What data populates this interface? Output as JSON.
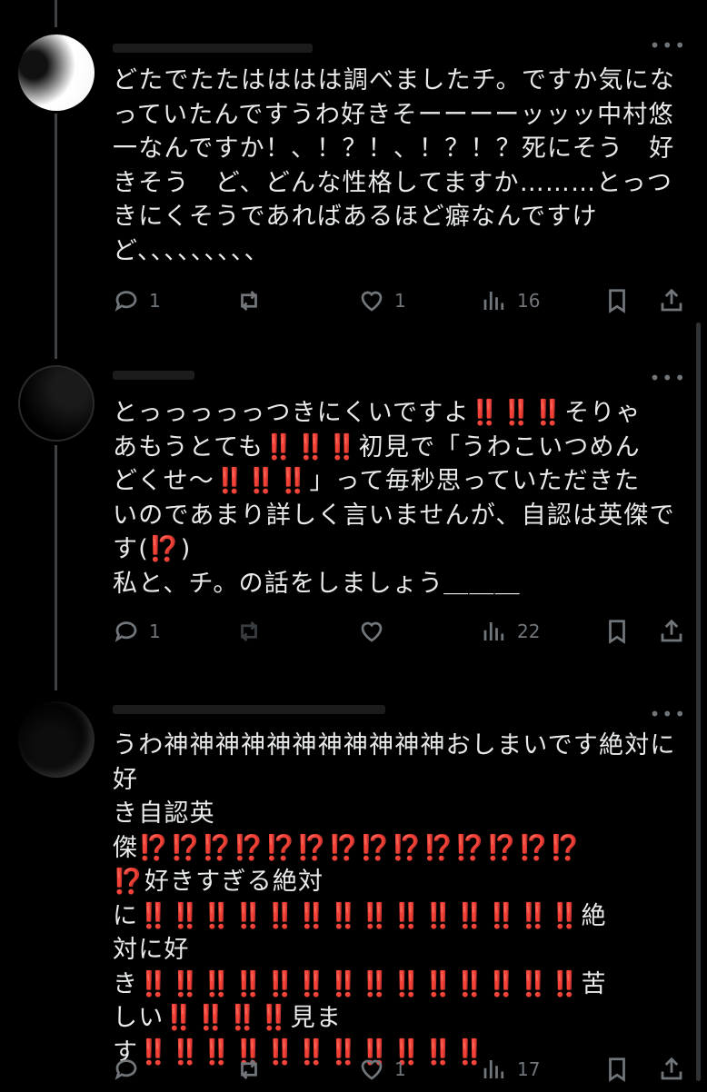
{
  "posts": [
    {
      "text": "どたでたたはははは調べましたチ。ですか気にな\nっていたんですうわ好きそーーーーッッッ中村悠\n一なんですか！、！？！、！？！？死にそう　好\nきそう　ど、どんな性格してますか………とっつ\nきにくそうであればあるほど癖なんですけ\nど、、、、、、、、、",
      "reply_count": "1",
      "repost_count": "",
      "like_count": "1",
      "view_count": "16"
    },
    {
      "text": "とっっっっっつきにくいですよ‼️‼️‼️そりゃ\nあもうとても‼️‼️‼️初見で「うわこいつめん\nどくせ〜‼️‼️‼️」って毎秒思っていただきた\nいのであまり詳しく言いませんが、自認は英傑で\nす(⁉️)\n私と、チ。の話をしましょう＿＿＿",
      "reply_count": "1",
      "repost_count": "",
      "like_count": "",
      "view_count": "22"
    },
    {
      "text": "うわ神神神神神神神神神神神おしまいです絶対に好\nき自認英\n傑⁉️⁉️⁉️⁉️⁉️⁉️⁉️⁉️⁉️⁉️⁉️⁉️⁉️⁉️\n⁉️好きすぎる絶対\nに‼️‼️‼️‼️‼️‼️‼️‼️‼️‼️‼️‼️‼️‼️絶\n対に好\nき‼️‼️‼️‼️‼️‼️‼️‼️‼️‼️‼️‼️‼️‼️苦\nしい‼️‼️‼️‼️見ま\nす‼️‼️‼️‼️‼️‼️‼️‼️‼️‼️‼️",
      "reply_count": "",
      "repost_count": "",
      "like_count": "1",
      "view_count": "17"
    }
  ],
  "icons": {
    "more": "more-icon",
    "reply": "reply-icon",
    "repost": "repost-icon",
    "like": "heart-icon",
    "views": "views-icon",
    "bookmark": "bookmark-icon",
    "share": "share-icon"
  },
  "colors": {
    "background": "#000000",
    "text": "#e7e9ea",
    "secondary": "#71767b"
  }
}
